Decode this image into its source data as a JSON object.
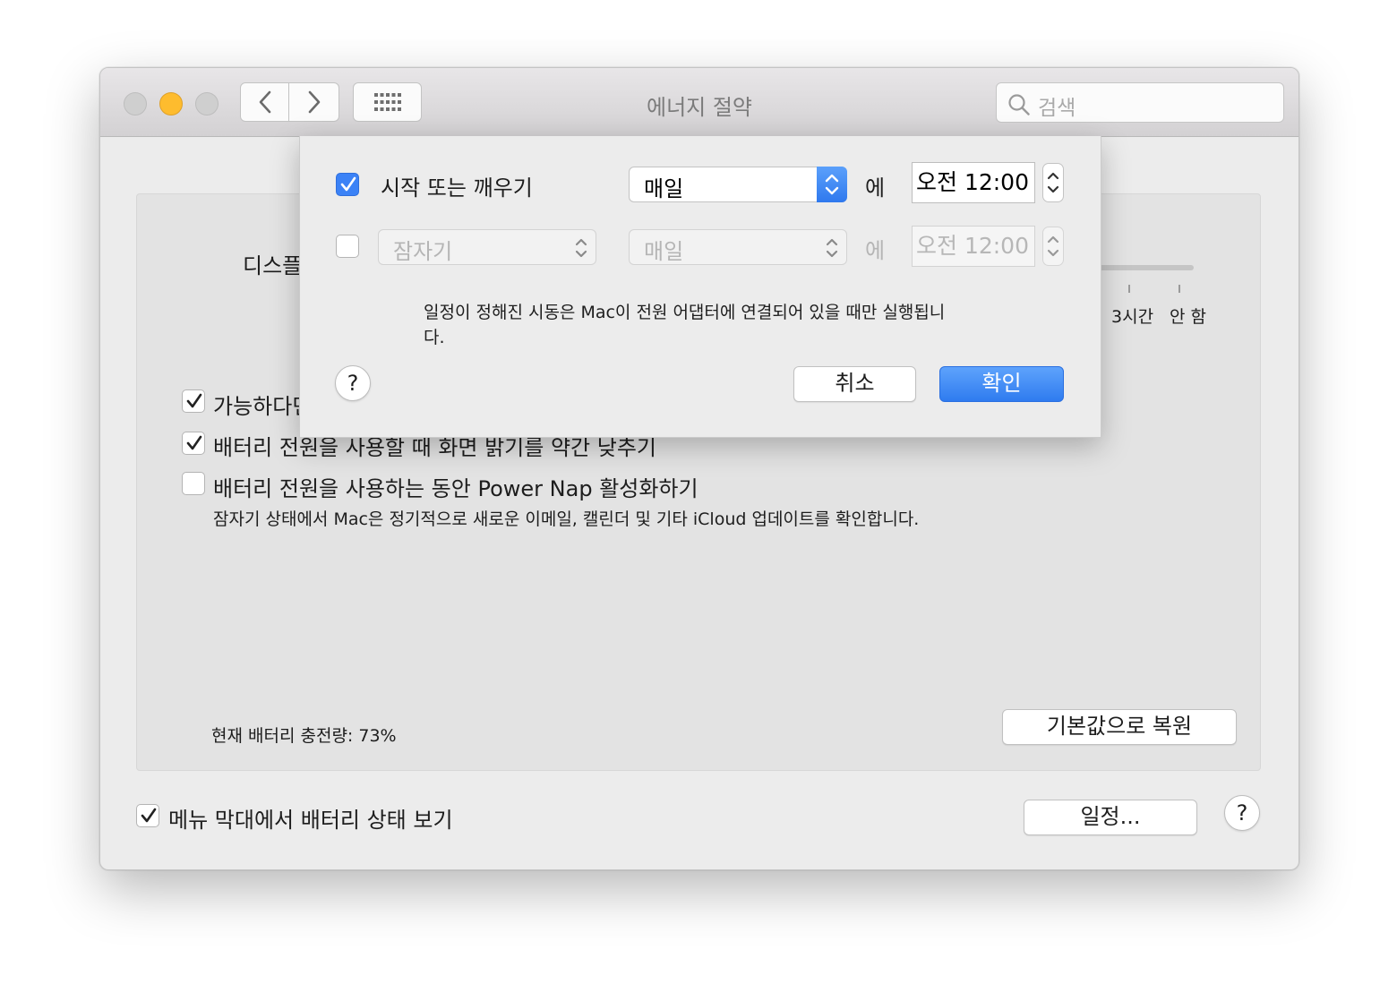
{
  "window": {
    "title": "에너지 절약"
  },
  "toolbar": {
    "search_placeholder": "검색",
    "back_icon": "chevron-left-icon",
    "forward_icon": "chevron-right-icon",
    "grid_icon": "grid-icon"
  },
  "main": {
    "display_label": "디스플",
    "slider_ticks": [
      "3시간",
      "안 함"
    ],
    "options": [
      {
        "label": "가능하다면",
        "checked": true
      },
      {
        "label": "배터리 전원을 사용할 때 화면 밝기를 약간 낮추기",
        "checked": true
      },
      {
        "label": "배터리 전원을 사용하는 동안 Power Nap 활성화하기",
        "checked": false
      }
    ],
    "power_nap_description": "잠자기 상태에서 Mac은 정기적으로 새로운 이메일, 캘린더 및 기타 iCloud 업데이트를 확인합니다.",
    "battery_status": "현재 배터리 충전량: 73%",
    "restore_defaults_label": "기본값으로 복원"
  },
  "footer": {
    "menu_bar_checkbox_label": "메뉴 막대에서 배터리 상태 보기",
    "menu_bar_checked": true,
    "schedule_button_label": "일정...",
    "help_label": "?"
  },
  "sheet": {
    "row1": {
      "checked": true,
      "label": "시작 또는 깨우기",
      "frequency": "매일",
      "at_label": "에",
      "time": "오전 12:00"
    },
    "row2": {
      "checked": false,
      "action": "잠자기",
      "frequency": "매일",
      "at_label": "에",
      "time": "오전 12:00"
    },
    "note_line1": "일정이 정해진 시동은 Mac이 전원 어댑터에 연결되어 있을 때만 실행됩니",
    "note_line2": "다.",
    "help_label": "?",
    "cancel_label": "취소",
    "ok_label": "확인"
  },
  "colors": {
    "accent": "#2f7bef",
    "minimize": "#febc2e",
    "window_bg": "#ececec"
  }
}
